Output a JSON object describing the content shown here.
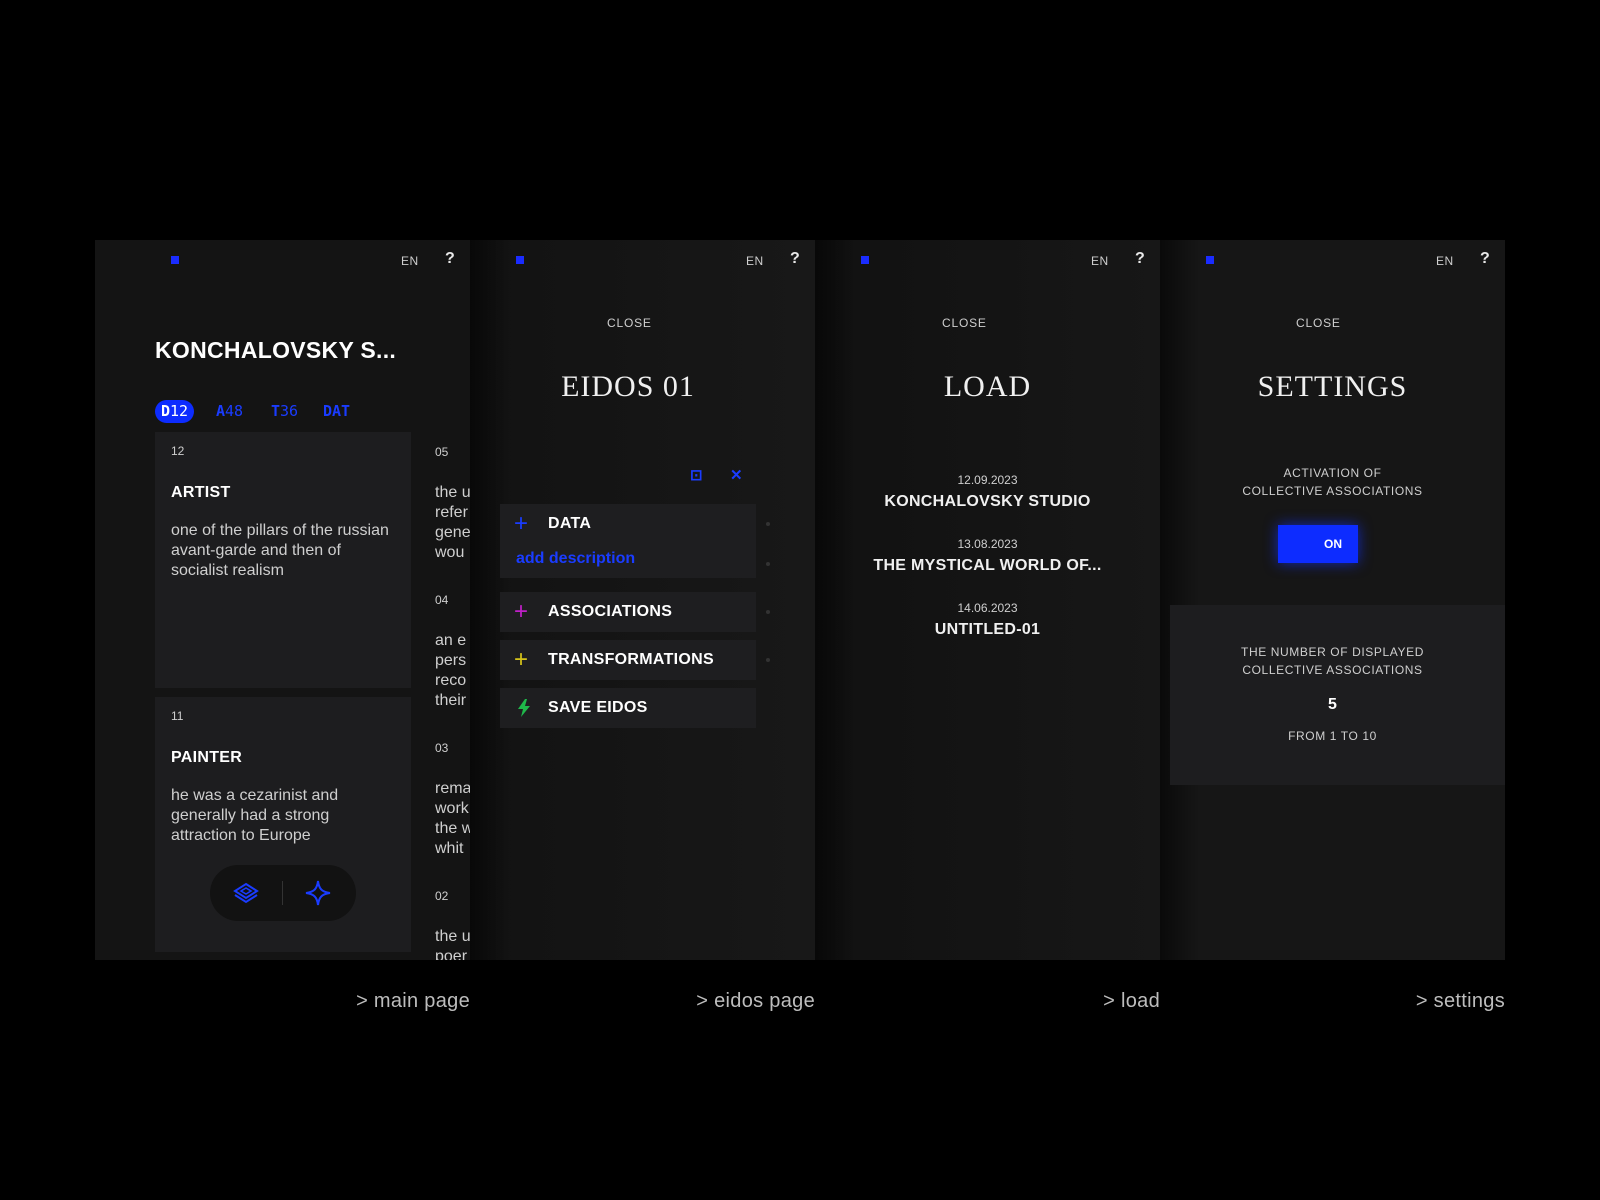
{
  "header": {
    "lang": "EN",
    "help": "?"
  },
  "main": {
    "title": "KONCHALOVSKY S...",
    "tabs": [
      {
        "letter": "D",
        "num": "12"
      },
      {
        "letter": "A",
        "num": "48"
      },
      {
        "letter": "T",
        "num": "36"
      },
      {
        "letter": "DAT",
        "num": ""
      }
    ],
    "cards": [
      {
        "num": "12",
        "title": "ARTIST",
        "desc": "one of the pillars of the russian avant-garde and then of socialist realism"
      },
      {
        "num": "11",
        "title": "PAINTER",
        "desc": "he was a cezarinist and generally had a strong attraction to Europe"
      }
    ],
    "column2": [
      {
        "num": "05",
        "text": "the u\nrefer\ngene\nwou"
      },
      {
        "num": "04",
        "text": "an e\npers\nreco\ntheir"
      },
      {
        "num": "03",
        "text": "rema\nwork\nthe w\nwhit"
      },
      {
        "num": "02",
        "text": "the u\npoer"
      }
    ],
    "actions": {
      "left_icon": "layers-icon",
      "right_icon": "sparkle-icon"
    }
  },
  "eidos": {
    "close": "CLOSE",
    "title": "EIDOS 01",
    "tools": {
      "expand": "⊡",
      "close": "✕"
    },
    "rows": [
      {
        "label": "DATA",
        "color": "#1a3cff"
      },
      {
        "label": "ASSOCIATIONS",
        "color": "#c020c8"
      },
      {
        "label": "TRANSFORMATIONS",
        "color": "#d4c21a"
      },
      {
        "label": "SAVE EIDOS",
        "color": "#1fb84a"
      }
    ],
    "add_description": "add description"
  },
  "load": {
    "close": "CLOSE",
    "title": "LOAD",
    "items": [
      {
        "date": "12.09.2023",
        "name": "KONCHALOVSKY STUDIO"
      },
      {
        "date": "13.08.2023",
        "name": "THE MYSTICAL WORLD OF..."
      },
      {
        "date": "14.06.2023",
        "name": "UNTITLED-01"
      }
    ]
  },
  "settings": {
    "close": "CLOSE",
    "title": "SETTINGS",
    "activation_line1": "ACTIVATION OF",
    "activation_line2": "COLLECTIVE ASSOCIATIONS",
    "toggle_label": "ON",
    "count_line1": "THE NUMBER OF DISPLAYED",
    "count_line2": "COLLECTIVE ASSOCIATIONS",
    "count_value": "5",
    "count_range": "FROM 1 TO 10"
  },
  "captions": {
    "main": "> main page",
    "eidos": "> eidos page",
    "load": "> load",
    "settings": "> settings"
  }
}
